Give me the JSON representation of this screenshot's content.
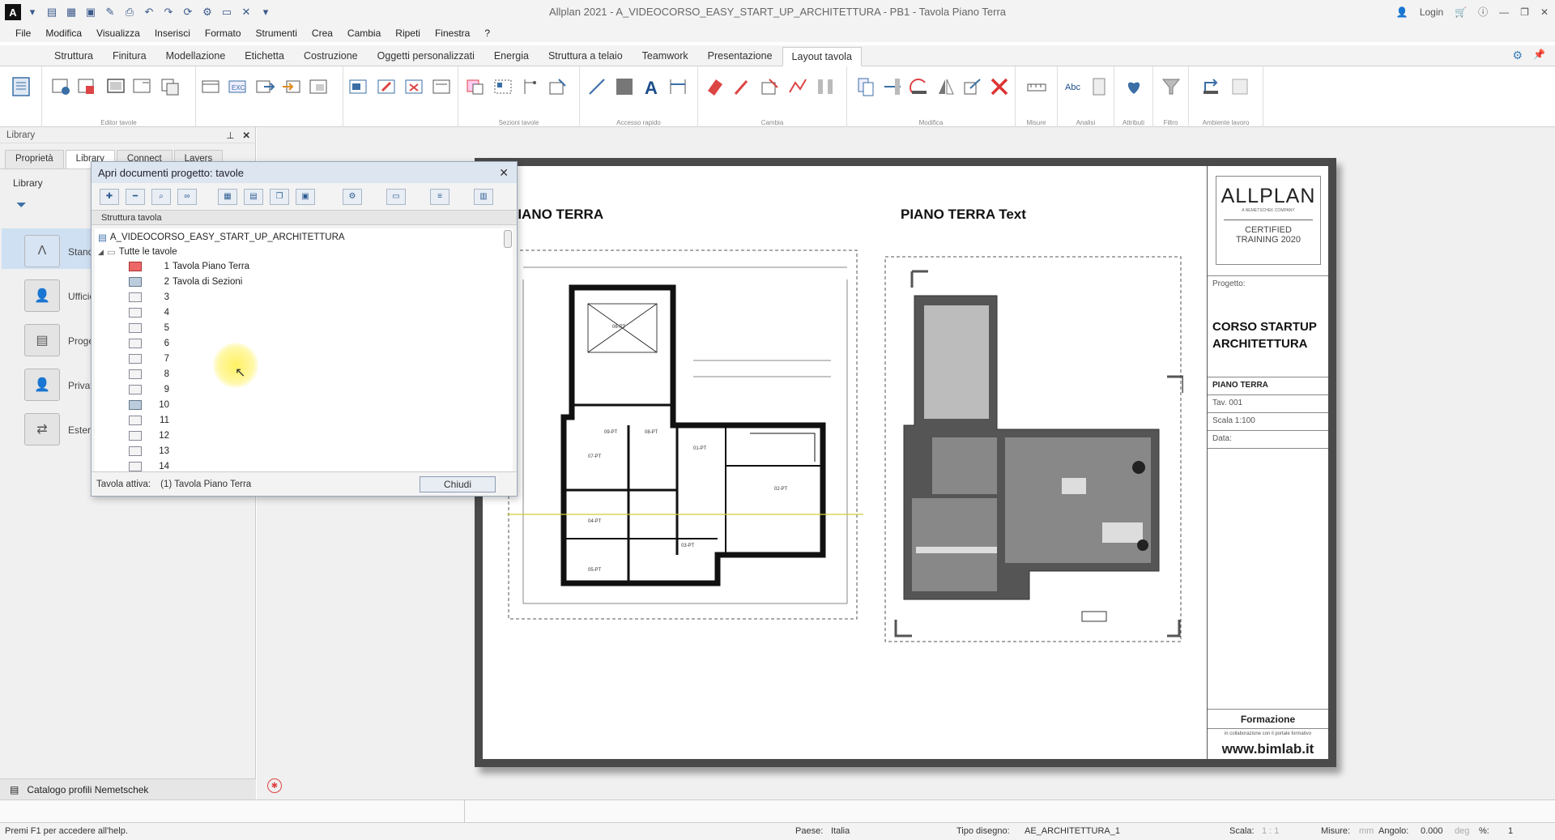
{
  "app": {
    "title": "Allplan 2021 - A_VIDEOCORSO_EASY_START_UP_ARCHITETTURA - PB1 - Tavola Piano Terra",
    "login": "Login",
    "help": "?"
  },
  "menu": [
    "File",
    "Modifica",
    "Visualizza",
    "Inserisci",
    "Formato",
    "Strumenti",
    "Crea",
    "Cambia",
    "Ripeti",
    "Finestra",
    "?"
  ],
  "ribbon": {
    "tabs": [
      "Struttura",
      "Finitura",
      "Modellazione",
      "Etichetta",
      "Costruzione",
      "Oggetti personalizzati",
      "Energia",
      "Struttura a telaio",
      "Teamwork",
      "Presentazione",
      "Layout tavola"
    ],
    "active_tab": "Layout tavola",
    "groups": [
      "Editor tavole",
      "Sezioni tavole",
      "Accesso rapido",
      "Cambia",
      "Modifica",
      "Misure",
      "Analisi",
      "Attributi",
      "Filtro",
      "Ambiente lavoro"
    ]
  },
  "library_panel": {
    "title": "Library",
    "tabs": [
      "Proprietà",
      "Library",
      "Connect",
      "Layers"
    ],
    "section": "Library",
    "items": [
      "Standard",
      "Ufficio",
      "Progetto",
      "Privato",
      "Esterno"
    ],
    "catalog": "Catalogo profili Nemetschek"
  },
  "dialog": {
    "title": "Apri documenti progetto: tavole",
    "header": "Struttura tavola",
    "project": "A_VIDEOCORSO_EASY_START_UP_ARCHITETTURA",
    "group": "Tutte le tavole",
    "sheets": [
      {
        "num": "1",
        "name": "Tavola Piano Terra"
      },
      {
        "num": "2",
        "name": "Tavola di Sezioni"
      },
      {
        "num": "3",
        "name": ""
      },
      {
        "num": "4",
        "name": ""
      },
      {
        "num": "5",
        "name": ""
      },
      {
        "num": "6",
        "name": ""
      },
      {
        "num": "7",
        "name": ""
      },
      {
        "num": "8",
        "name": ""
      },
      {
        "num": "9",
        "name": ""
      },
      {
        "num": "10",
        "name": ""
      },
      {
        "num": "11",
        "name": ""
      },
      {
        "num": "12",
        "name": ""
      },
      {
        "num": "13",
        "name": ""
      },
      {
        "num": "14",
        "name": ""
      }
    ],
    "active_label": "Tavola attiva:",
    "active_value": "(1)  Tavola Piano Terra",
    "close_button": "Chiudi"
  },
  "sheet": {
    "title_left": "PIANO TERRA",
    "title_right": "PIANO TERRA Text",
    "titleblock": {
      "logo": "ALLPLAN",
      "logo_sub": "A NEMETSCHEK COMPANY",
      "cert1": "CERTIFIED",
      "cert2": "TRAINING 2020",
      "progetto_label": "Progetto:",
      "project_name1": "CORSO STARTUP",
      "project_name2": "ARCHITETTURA",
      "floor": "PIANO TERRA",
      "tav": "Tav. 001",
      "scale": "Scala 1:100",
      "date": "Data:",
      "formazione": "Formazione",
      "collab": "in collaborazione con il portale formativo",
      "website": "www.bimlab.it"
    }
  },
  "statusbar": {
    "help": "Premi F1 per accedere all'help.",
    "paese_label": "Paese:",
    "paese": "Italia",
    "tipo_label": "Tipo disegno:",
    "tipo": "AE_ARCHITETTURA_1",
    "scala_label": "Scala:",
    "scala": "1 : 1",
    "misure_label": "Misure:",
    "misure": "mm",
    "angolo_label": "Angolo:",
    "angolo": "0.000",
    "deg": "deg",
    "pct_label": "%:",
    "pct": "1"
  }
}
